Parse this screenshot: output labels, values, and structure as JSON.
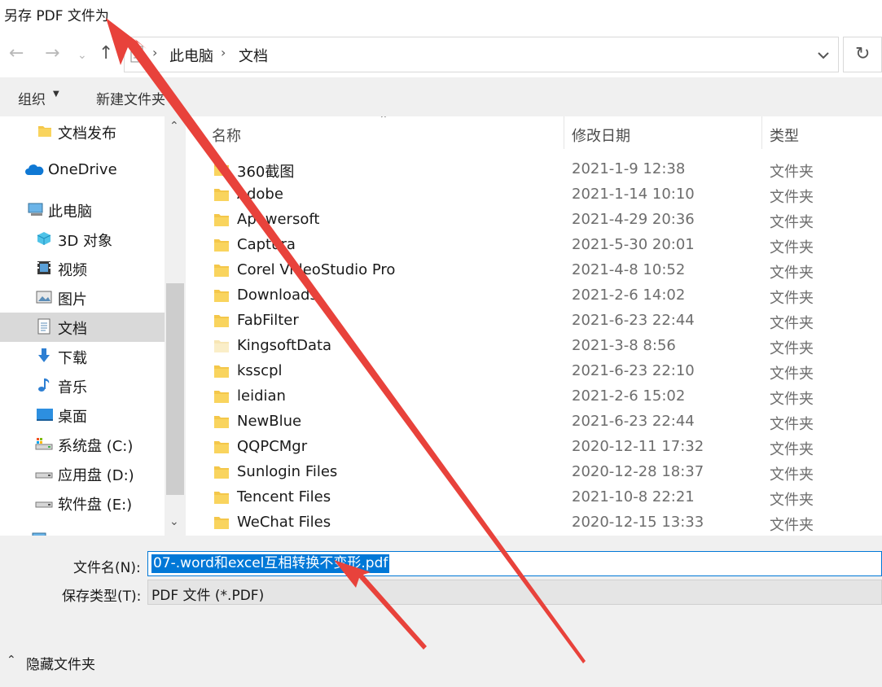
{
  "window": {
    "title": "另存 PDF 文件为"
  },
  "address": {
    "breadcrumb": [
      "此电脑",
      "文档"
    ]
  },
  "toolbar": {
    "organize_label": "组织",
    "new_folder_label": "新建文件夹"
  },
  "navpane": {
    "items": [
      {
        "label": "文档发布",
        "icon": "folder-icon"
      },
      {
        "label": "OneDrive",
        "icon": "cloud-icon"
      },
      {
        "label": "此电脑",
        "icon": "computer-icon"
      },
      {
        "label": "3D 对象",
        "icon": "cube-icon"
      },
      {
        "label": "视频",
        "icon": "video-icon"
      },
      {
        "label": "图片",
        "icon": "picture-icon"
      },
      {
        "label": "文档",
        "icon": "document-icon",
        "selected": true
      },
      {
        "label": "下载",
        "icon": "download-icon"
      },
      {
        "label": "音乐",
        "icon": "music-icon"
      },
      {
        "label": "桌面",
        "icon": "desktop-icon"
      },
      {
        "label": "系统盘 (C:)",
        "icon": "system-drive-icon"
      },
      {
        "label": "应用盘 (D:)",
        "icon": "drive-icon"
      },
      {
        "label": "软件盘 (E:)",
        "icon": "drive-icon"
      }
    ]
  },
  "filelist": {
    "headers": {
      "name": "名称",
      "date": "修改日期",
      "type": "类型"
    },
    "rows": [
      {
        "name": "360截图",
        "date": "2021-1-9 12:38",
        "type": "文件夹"
      },
      {
        "name": "Adobe",
        "date": "2021-1-14 10:10",
        "type": "文件夹"
      },
      {
        "name": "Apowersoft",
        "date": "2021-4-29 20:36",
        "type": "文件夹"
      },
      {
        "name": "Captura",
        "date": "2021-5-30 20:01",
        "type": "文件夹"
      },
      {
        "name": "Corel VideoStudio Pro",
        "date": "2021-4-8 10:52",
        "type": "文件夹"
      },
      {
        "name": "Downloads",
        "date": "2021-2-6 14:02",
        "type": "文件夹"
      },
      {
        "name": "FabFilter",
        "date": "2021-6-23 22:44",
        "type": "文件夹"
      },
      {
        "name": "KingsoftData",
        "date": "2021-3-8 8:56",
        "type": "文件夹",
        "hidden": true
      },
      {
        "name": "ksscpl",
        "date": "2021-6-23 22:10",
        "type": "文件夹"
      },
      {
        "name": "leidian",
        "date": "2021-2-6 15:02",
        "type": "文件夹"
      },
      {
        "name": "NewBlue",
        "date": "2021-6-23 22:44",
        "type": "文件夹"
      },
      {
        "name": "QQPCMgr",
        "date": "2020-12-11 17:32",
        "type": "文件夹"
      },
      {
        "name": "Sunlogin Files",
        "date": "2020-12-28 18:37",
        "type": "文件夹"
      },
      {
        "name": "Tencent Files",
        "date": "2021-10-8 22:21",
        "type": "文件夹"
      },
      {
        "name": "WeChat Files",
        "date": "2020-12-15 13:33",
        "type": "文件夹"
      }
    ]
  },
  "form": {
    "filename_label": "文件名(N):",
    "filename_value": "07-.word和excel互相转换不变形.pdf",
    "savetype_label": "保存类型(T):",
    "savetype_value": "PDF 文件 (*.PDF)",
    "hide_folders_label": "隐藏文件夹"
  },
  "colors": {
    "accent": "#0078d7",
    "folder": "#f4c74a",
    "arrow": "#e8423b"
  }
}
